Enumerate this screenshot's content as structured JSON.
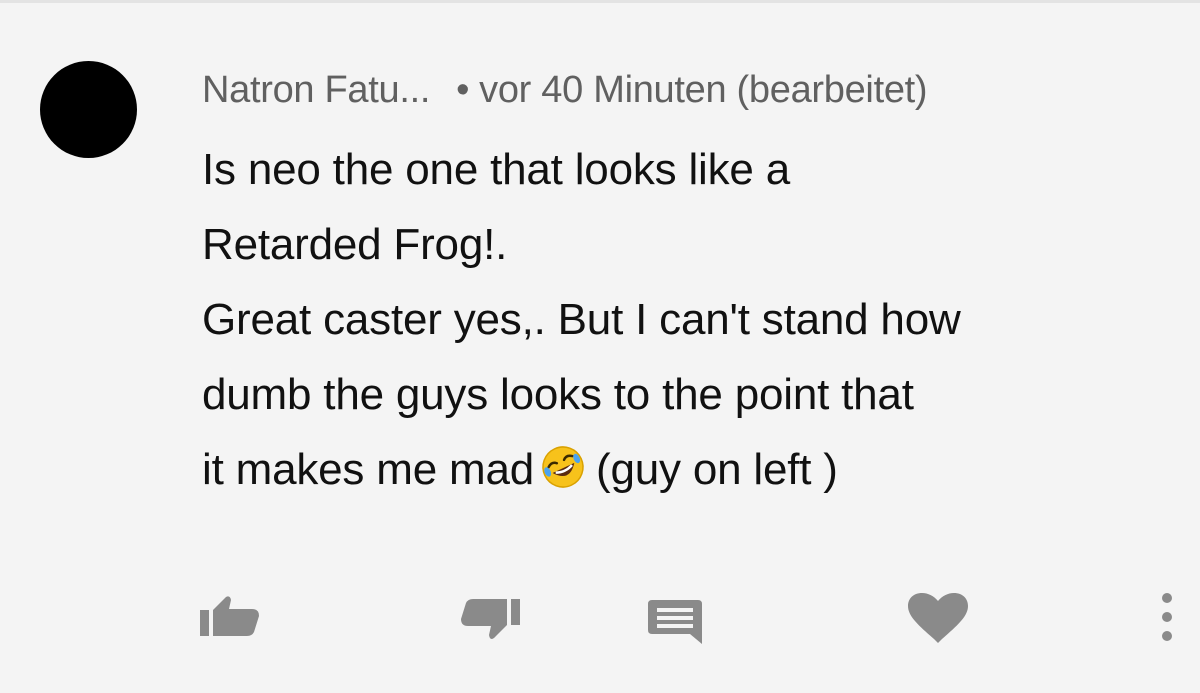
{
  "comment": {
    "author": "Natron Fatu...",
    "separator": "•",
    "timestamp": "vor 40 Minuten (bearbeitet)",
    "text_lines": [
      "Is neo the one that looks like a",
      "Retarded Frog!.",
      "Great caster yes,. But I can't stand how",
      "dumb the guys looks to the point that"
    ],
    "last_line_before_emoji": "it makes me mad",
    "emoji": "rolling-on-floor-laughing-emoji",
    "last_line_after_emoji": "(guy on left )"
  },
  "actions": {
    "icons": [
      "thumbs-up-icon",
      "thumbs-down-icon",
      "reply-comment-icon",
      "heart-icon",
      "more-vertical-icon"
    ],
    "icon_color": "#8a8a8a"
  },
  "colors": {
    "background": "#f4f4f4",
    "avatar": "#000000",
    "meta_text": "#606060",
    "body_text": "#111111",
    "emoji_yellow": "#f7c21b"
  }
}
